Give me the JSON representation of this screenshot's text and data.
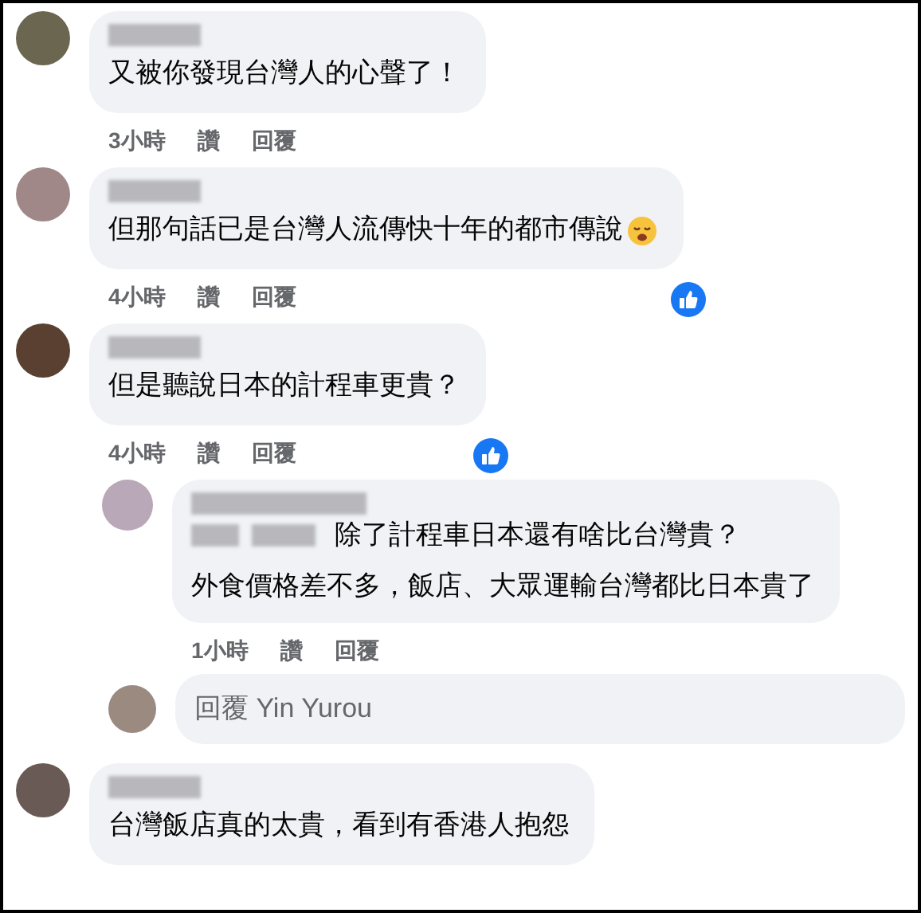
{
  "comments": [
    {
      "kind": "comment",
      "color": "#6b6650",
      "text": "又被你發現台灣人的心聲了！",
      "emoji": false,
      "time": "3小時",
      "like": "讚",
      "reply": "回覆",
      "liked": false
    },
    {
      "kind": "comment",
      "color": "#a08888",
      "text": "但那句話已是台灣人流傳快十年的都市傳說",
      "emoji": true,
      "time": "4小時",
      "like": "讚",
      "reply": "回覆",
      "liked": true
    },
    {
      "kind": "comment",
      "color": "#5a4030",
      "text": "但是聽說日本的計程車更貴？",
      "emoji": false,
      "time": "4小時",
      "like": "讚",
      "reply": "回覆",
      "liked": true
    },
    {
      "kind": "reply",
      "color": "#b8a8b8",
      "text": "除了計程車日本還有啥比台灣貴？",
      "text_2": "外食價格差不多，飯店、大眾運輸台灣都比日本貴了",
      "emoji": false,
      "time": "1小時",
      "like": "讚",
      "reply": "回覆",
      "liked": false
    },
    {
      "kind": "reply_field",
      "color": "#9a8a80",
      "placeholder": "回覆 Yin Yurou"
    },
    {
      "kind": "comment",
      "color": "#6a5a55",
      "text": "台灣飯店真的太貴，看到有香港人抱怨",
      "emoji": false
    }
  ]
}
